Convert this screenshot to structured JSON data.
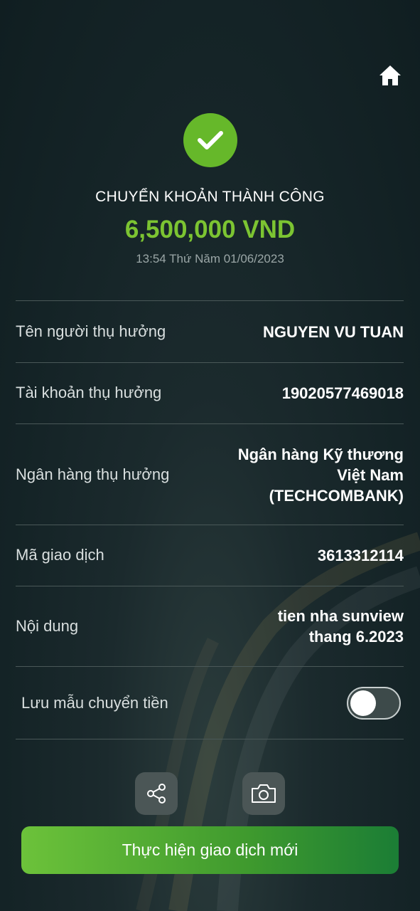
{
  "header": {
    "home_icon": "home-icon"
  },
  "status": {
    "icon": "check-icon",
    "title": "CHUYỂN KHOẢN THÀNH CÔNG",
    "amount": "6,500,000 VND",
    "datetime": "13:54 Thứ Năm 01/06/2023",
    "accent_color": "#7cc432"
  },
  "details": {
    "beneficiary_name": {
      "label": "Tên người thụ hưởng",
      "value": "NGUYEN VU TUAN"
    },
    "beneficiary_account": {
      "label": "Tài khoản thụ hưởng",
      "value": "19020577469018"
    },
    "beneficiary_bank": {
      "label": "Ngân hàng thụ hưởng",
      "value_lines": [
        "Ngân hàng Kỹ thương",
        "Việt Nam",
        "(TECHCOMBANK)"
      ]
    },
    "transaction_code": {
      "label": "Mã giao dịch",
      "value": "3613312114"
    },
    "content": {
      "label": "Nội dung",
      "value_lines": [
        "tien nha sunview",
        "thang 6.2023"
      ]
    }
  },
  "save_template": {
    "label": "Lưu mẫu chuyển tiền",
    "enabled": false
  },
  "actions": {
    "share_icon": "share-icon",
    "screenshot_icon": "camera-icon",
    "new_transaction_label": "Thực hiện giao dịch mới"
  }
}
